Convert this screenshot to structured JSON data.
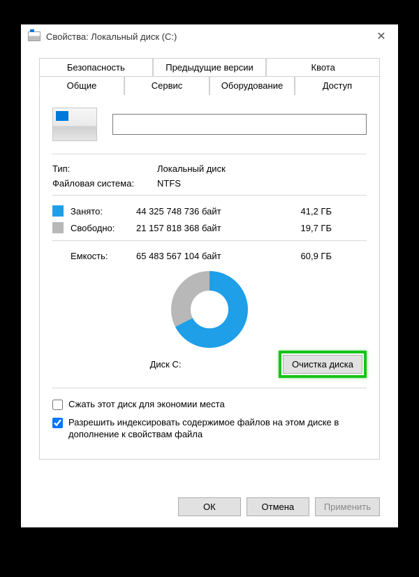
{
  "window": {
    "title": "Свойства: Локальный диск (C:)",
    "close": "✕"
  },
  "tabs": {
    "back": [
      "Безопасность",
      "Предыдущие версии",
      "Квота"
    ],
    "front": [
      "Общие",
      "Сервис",
      "Оборудование",
      "Доступ"
    ],
    "active": "Общие"
  },
  "nameField": "",
  "info": {
    "typeLabel": "Тип:",
    "typeValue": "Локальный диск",
    "fsLabel": "Файловая система:",
    "fsValue": "NTFS"
  },
  "space": {
    "usedLabel": "Занято:",
    "usedBytes": "44 325 748 736 байт",
    "usedHuman": "41,2 ГБ",
    "freeLabel": "Свободно:",
    "freeBytes": "21 157 818 368 байт",
    "freeHuman": "19,7 ГБ",
    "capLabel": "Емкость:",
    "capBytes": "65 483 567 104 байт",
    "capHuman": "60,9 ГБ"
  },
  "diskLabel": "Диск C:",
  "cleanupBtn": "Очистка диска",
  "checks": {
    "compress": "Сжать этот диск для экономии места",
    "compressChecked": false,
    "index": "Разрешить индексировать содержимое файлов на этом диске в дополнение к свойствам файла",
    "indexChecked": true
  },
  "buttons": {
    "ok": "ОК",
    "cancel": "Отмена",
    "apply": "Применить"
  },
  "chart_data": {
    "type": "pie",
    "title": "Диск C:",
    "series": [
      {
        "name": "Занято",
        "value": 44325748736,
        "human": "41,2 ГБ",
        "color": "#1e9fe8"
      },
      {
        "name": "Свободно",
        "value": 21157818368,
        "human": "19,7 ГБ",
        "color": "#b8b8b8"
      }
    ],
    "total": {
      "name": "Емкость",
      "value": 65483567104,
      "human": "60,9 ГБ"
    }
  }
}
